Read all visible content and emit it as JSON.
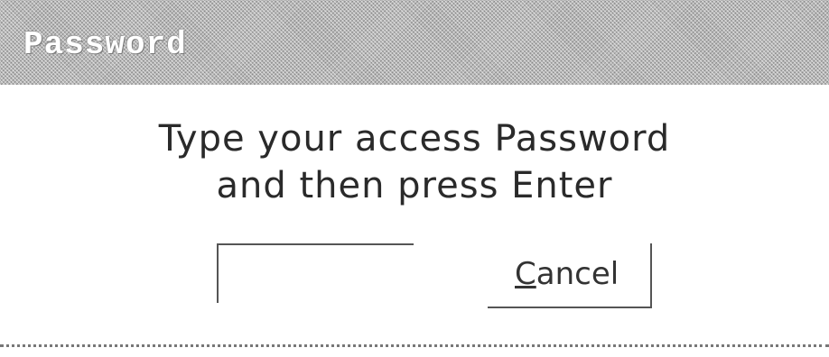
{
  "window": {
    "title": "Password"
  },
  "prompt": {
    "line1": "Type your access Password",
    "line2": "and then press Enter"
  },
  "password_input": {
    "value": "",
    "placeholder": ""
  },
  "cancel_button": {
    "mnemonic": "C",
    "rest": "ancel"
  },
  "colors": {
    "title_bar": "#b8b8b8",
    "title_text": "#ffffff",
    "background": "#ffffff",
    "text": "#2a2a2a"
  }
}
